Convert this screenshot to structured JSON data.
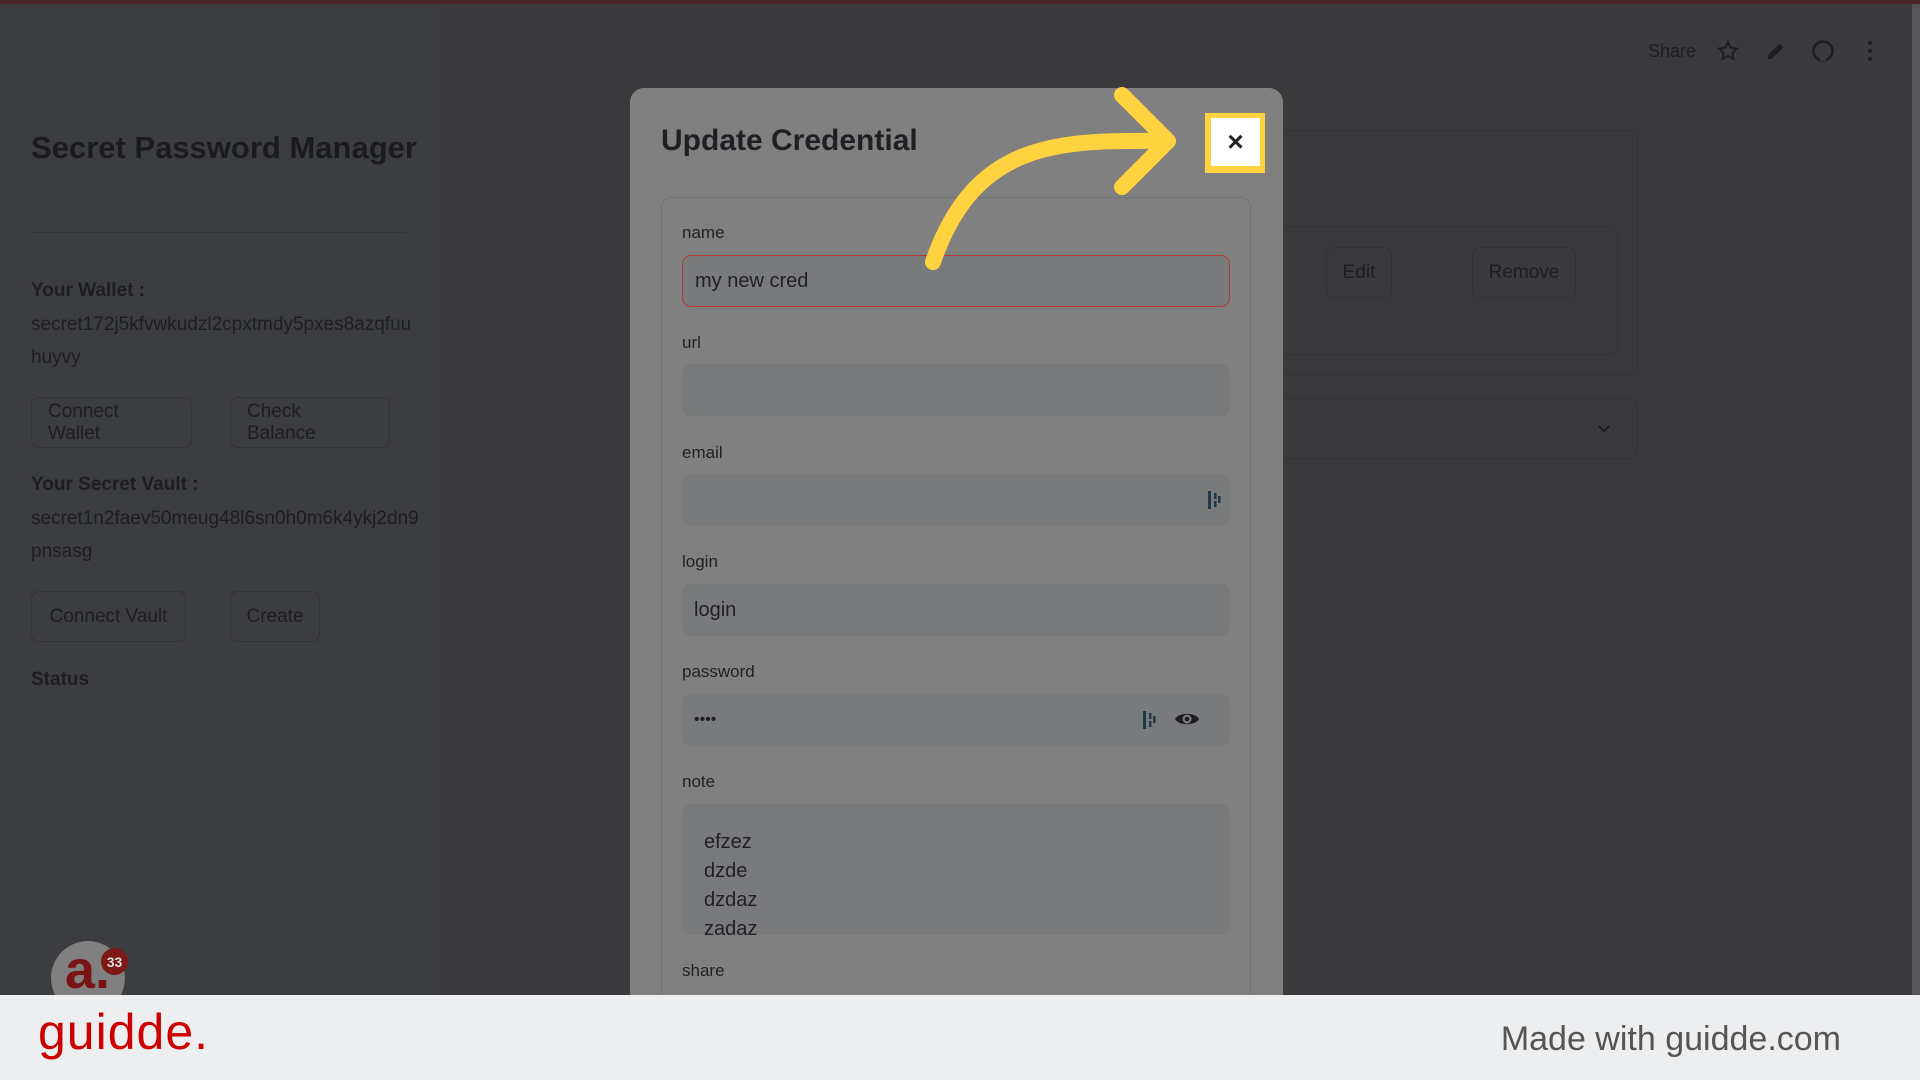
{
  "sidebar": {
    "title": "Secret Password Manager",
    "wallet_label": "Your Wallet :",
    "wallet_address": "secret172j5kfvwkudzl2cpxtmdy5pxes8azqfuuhuyvy",
    "connect_wallet": "Connect Wallet",
    "check_balance": "Check Balance",
    "vault_label": "Your Secret Vault :",
    "vault_address": "secret1n2faev50meug48l6sn0h0m6k4ykj2dn9pnsasg",
    "connect_vault": "Connect Vault",
    "create": "Create",
    "status_label": "Status"
  },
  "header": {
    "share": "Share",
    "icons": [
      "star-icon",
      "pencil-icon",
      "github-icon",
      "more-vertical-icon"
    ]
  },
  "background": {
    "edit": "Edit",
    "remove": "Remove"
  },
  "modal": {
    "title": "Update Credential",
    "close": "×",
    "fields": {
      "name": {
        "label": "name",
        "value": "my new cred"
      },
      "url": {
        "label": "url",
        "value": ""
      },
      "email": {
        "label": "email",
        "value": ""
      },
      "login": {
        "label": "login",
        "value": "login"
      },
      "password": {
        "label": "password",
        "value": "••••"
      },
      "note": {
        "label": "note",
        "lines": [
          "efzez",
          "dzde",
          "dzdaz",
          "zadaz"
        ]
      },
      "share": {
        "label": "share"
      }
    }
  },
  "avatar": {
    "badge": "33"
  },
  "footer": {
    "logo": "guidde.",
    "tagline": "Made with guidde.com"
  },
  "colors": {
    "highlight": "#ffd23f",
    "brand": "#cc0000",
    "error_border": "#b5393a"
  }
}
